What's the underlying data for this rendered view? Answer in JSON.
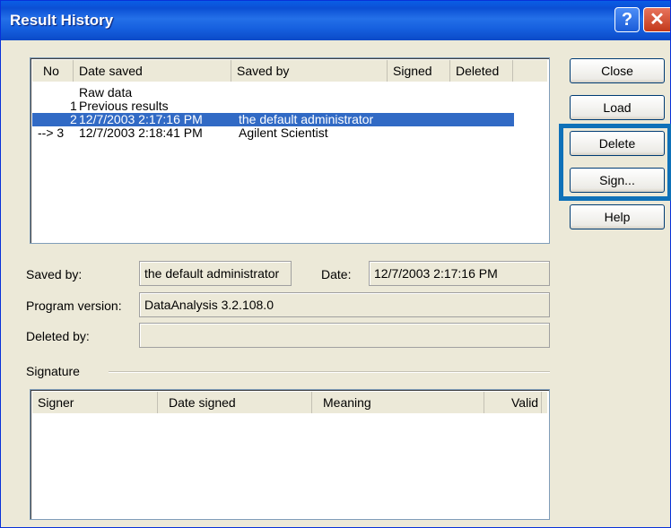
{
  "window": {
    "title": "Result History",
    "help_glyph": "?",
    "close_glyph": "✕"
  },
  "history": {
    "columns": [
      "No",
      "Date saved",
      "Saved by",
      "Signed",
      "Deleted"
    ],
    "rows": [
      {
        "no": "",
        "date": "Raw data",
        "by": ""
      },
      {
        "no": "1",
        "date": "Previous results",
        "by": ""
      },
      {
        "no": "2",
        "date": "12/7/2003 2:17:16 PM",
        "by": "the default administrator"
      },
      {
        "no": "--> 3",
        "date": "12/7/2003 2:18:41 PM",
        "by": "Agilent Scientist"
      }
    ],
    "selected_row": 2
  },
  "details": {
    "saved_by_label": "Saved by:",
    "saved_by_value": "the default administrator",
    "date_label": "Date:",
    "date_value": "12/7/2003 2:17:16 PM",
    "program_version_label": "Program version:",
    "program_version_value": "DataAnalysis 3.2.108.0",
    "deleted_by_label": "Deleted by:",
    "deleted_by_value": ""
  },
  "signature": {
    "group_label": "Signature",
    "columns": [
      "Signer",
      "Date signed",
      "Meaning",
      "Valid"
    ]
  },
  "buttons": {
    "close": "Close",
    "load": "Load",
    "delete": "Delete",
    "sign": "Sign...",
    "help": "Help"
  },
  "colors": {
    "title_bar": "#0b4fd4",
    "selection": "#316ac5",
    "highlight_frame": "#0f71b8",
    "dialog_bg": "#ece9d8"
  }
}
